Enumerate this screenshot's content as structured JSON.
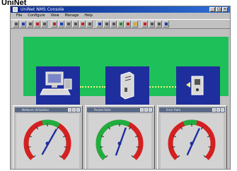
{
  "caption": "UniNet",
  "window": {
    "title": "UniNet NMS Console",
    "controls": [
      "_",
      "□",
      "×"
    ]
  },
  "menu": [
    "File",
    "Configure",
    "View",
    "Manage",
    "Help"
  ],
  "toolbar": {
    "buttons": [
      {
        "icon": "open-icon",
        "color": "c-gray"
      },
      {
        "icon": "save-icon",
        "color": "c-blue"
      },
      {
        "icon": "print-icon",
        "color": "c-gray"
      },
      {
        "icon": "stop-icon",
        "color": "c-red"
      },
      {
        "icon": "find-icon",
        "color": "c-gray"
      },
      {
        "icon": "delete-icon",
        "color": "c-red"
      },
      {
        "icon": "map-icon",
        "color": "c-blue"
      },
      {
        "icon": "node-icon",
        "color": "c-gray"
      },
      {
        "icon": "link-icon",
        "color": "c-gray"
      },
      {
        "icon": "alarm-icon",
        "color": "c-red"
      },
      {
        "icon": "chart-icon",
        "color": "c-gray"
      },
      {
        "icon": "stats-icon",
        "color": "c-blue"
      },
      {
        "icon": "config-icon",
        "color": "c-gray"
      },
      {
        "icon": "trace-icon",
        "color": "c-gray"
      },
      {
        "icon": "refresh-icon",
        "color": "c-green"
      },
      {
        "icon": "stop-poll-icon",
        "color": "c-red"
      },
      {
        "icon": "warning-icon",
        "color": "c-yellow"
      },
      {
        "icon": "bell-icon",
        "color": "c-red"
      },
      {
        "icon": "tile-icon",
        "color": "c-gray"
      },
      {
        "icon": "cascade-icon",
        "color": "c-gray"
      },
      {
        "icon": "help-icon",
        "color": "c-blue"
      }
    ]
  },
  "topology": {
    "background": "#1ec05a",
    "node_color": "#1e2e9c",
    "link_color": "#f2f27a",
    "nodes": [
      {
        "icon": "computer-icon"
      },
      {
        "icon": "server-icon"
      },
      {
        "icon": "device-icon"
      }
    ]
  },
  "gauges": [
    {
      "title": "Network Utilization",
      "value": 0.62,
      "green_from": 0.45,
      "green_to": 0.62
    },
    {
      "title": "Packet Rate",
      "value": 0.58,
      "green_from": 0.0,
      "green_to": 0.6
    },
    {
      "title": "Error Rate",
      "value": 0.6,
      "green_from": 0.42,
      "green_to": 0.55
    }
  ],
  "colors": {
    "gauge_red": "#d42020",
    "gauge_green": "#1fae3e",
    "needle": "#1e2ea0"
  }
}
